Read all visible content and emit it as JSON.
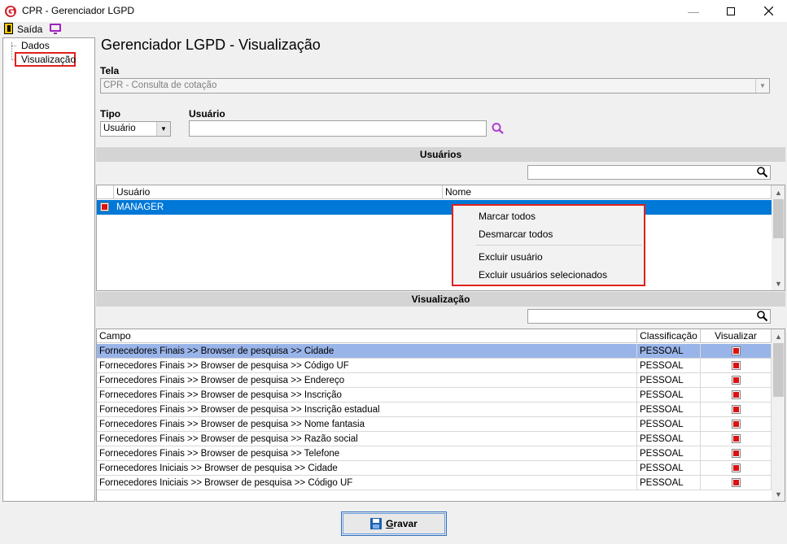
{
  "window": {
    "title": "CPR - Gerenciador LGPD"
  },
  "toolbar": {
    "exit_label": "Saída"
  },
  "tree": {
    "items": [
      "Dados",
      "Visualização"
    ]
  },
  "page": {
    "title": "Gerenciador LGPD - Visualização"
  },
  "tela": {
    "label": "Tela",
    "value": "CPR - Consulta de cotação"
  },
  "tipo": {
    "label": "Tipo",
    "value": "Usuário"
  },
  "usuario": {
    "label": "Usuário",
    "value": ""
  },
  "users_section": {
    "title": "Usuários",
    "columns": [
      "Usuário",
      "Nome"
    ],
    "rows": [
      {
        "usuario": "MANAGER",
        "nome": "",
        "checked": true
      }
    ]
  },
  "context_menu": {
    "items": [
      "Marcar todos",
      "Desmarcar todos",
      "Excluir usuário",
      "Excluir usuários selecionados"
    ]
  },
  "view_section": {
    "title": "Visualização",
    "columns": [
      "Campo",
      "Classificação",
      "Visualizar"
    ],
    "rows": [
      {
        "campo": "Fornecedores Finais >> Browser de pesquisa >> Cidade",
        "classificacao": "PESSOAL",
        "visualizar": true
      },
      {
        "campo": "Fornecedores Finais >> Browser de pesquisa >> Código UF",
        "classificacao": "PESSOAL",
        "visualizar": true
      },
      {
        "campo": "Fornecedores Finais >> Browser de pesquisa >> Endereço",
        "classificacao": "PESSOAL",
        "visualizar": true
      },
      {
        "campo": "Fornecedores Finais >> Browser de pesquisa >> Inscrição",
        "classificacao": "PESSOAL",
        "visualizar": true
      },
      {
        "campo": "Fornecedores Finais >> Browser de pesquisa >> Inscrição estadual",
        "classificacao": "PESSOAL",
        "visualizar": true
      },
      {
        "campo": "Fornecedores Finais >> Browser de pesquisa >> Nome fantasia",
        "classificacao": "PESSOAL",
        "visualizar": true
      },
      {
        "campo": "Fornecedores Finais >> Browser de pesquisa >> Razão social",
        "classificacao": "PESSOAL",
        "visualizar": true
      },
      {
        "campo": "Fornecedores Finais >> Browser de pesquisa >> Telefone",
        "classificacao": "PESSOAL",
        "visualizar": true
      },
      {
        "campo": "Fornecedores Iniciais >> Browser de pesquisa >> Cidade",
        "classificacao": "PESSOAL",
        "visualizar": true
      },
      {
        "campo": "Fornecedores Iniciais >> Browser de pesquisa >> Código UF",
        "classificacao": "PESSOAL",
        "visualizar": true
      }
    ]
  },
  "save_button": {
    "label": "Gravar"
  },
  "colors": {
    "selected_row": "#0078d7",
    "highlight_row": "#99b4e8",
    "accent_red": "#e0201c"
  }
}
